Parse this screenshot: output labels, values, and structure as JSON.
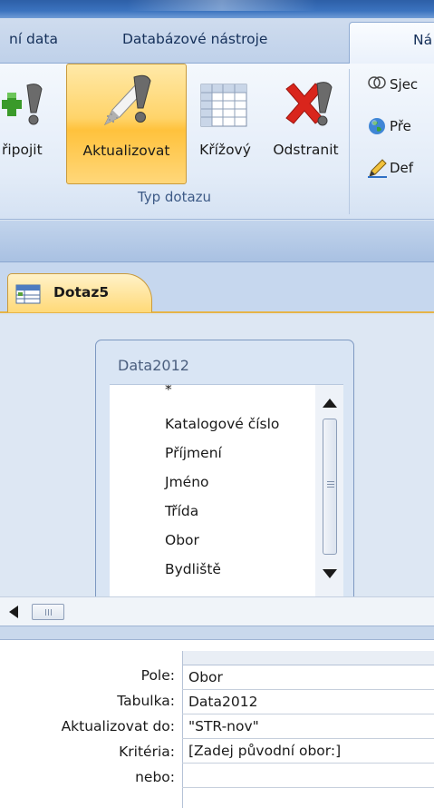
{
  "ribbon_tabs": [
    {
      "label": "ní data"
    },
    {
      "label": "Databázové nástroje"
    },
    {
      "label": "Ná"
    }
  ],
  "query_type_group": {
    "label": "Typ dotazu",
    "buttons": [
      {
        "label": "řipojit"
      },
      {
        "label": "Aktualizovat",
        "pressed": true
      },
      {
        "label": "Křížový"
      },
      {
        "label": "Odstranit"
      }
    ]
  },
  "side_commands": [
    {
      "label": "Sjec",
      "icon": "union-icon"
    },
    {
      "label": "Pře",
      "icon": "globe-icon"
    },
    {
      "label": "Def",
      "icon": "pencil-icon"
    }
  ],
  "document_tab": {
    "label": "Dotaz5"
  },
  "table": {
    "title": "Data2012",
    "fields": [
      "*",
      "Katalogové číslo",
      "Příjmení",
      "Jméno",
      "Třída",
      "Obor",
      "Bydliště"
    ]
  },
  "design_grid": {
    "rows": [
      {
        "label": "Pole:",
        "value": "Obor"
      },
      {
        "label": "Tabulka:",
        "value": "Data2012"
      },
      {
        "label": "Aktualizovat do:",
        "value": "\"STR-nov\""
      },
      {
        "label": "Kritéria:",
        "value": "[Zadej původní obor:]"
      },
      {
        "label": "nebo:",
        "value": ""
      }
    ]
  },
  "colors": {
    "accent": "#ffd46a",
    "ribbon": "#dbe5f1",
    "tab_text": "#15305a"
  }
}
